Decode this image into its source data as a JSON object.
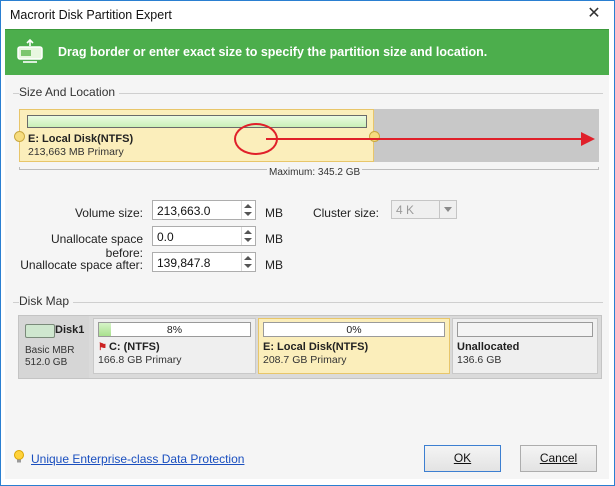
{
  "window": {
    "title": "Macrorit Disk Partition Expert",
    "close_glyph": "✕"
  },
  "banner": {
    "text": "Drag border or enter exact size to specify the partition size and location.",
    "icon": "partition-resize-icon"
  },
  "size_location": {
    "section_label": "Size And Location",
    "partition": {
      "name": "E: Local Disk(NTFS)",
      "sub": "213,663 MB Primary"
    },
    "maximum_label": "Maximum: 345.2 GB"
  },
  "fields": {
    "volume_size": {
      "label": "Volume size:",
      "value": "213,663.0",
      "unit": "MB"
    },
    "unalloc_before": {
      "label": "Unallocate space before:",
      "value": "0.0",
      "unit": "MB"
    },
    "unalloc_after": {
      "label": "Unallocate space after:",
      "value": "139,847.8",
      "unit": "MB"
    },
    "cluster_size": {
      "label": "Cluster size:",
      "value": "4 K"
    }
  },
  "disk_map": {
    "section_label": "Disk Map",
    "disk": {
      "name": "Disk1",
      "type": "Basic MBR",
      "size": "512.0 GB"
    },
    "partitions": [
      {
        "pct": "8%",
        "fill": 0.08,
        "name": "C: (NTFS)",
        "sub": "166.8 GB Primary",
        "selected": false
      },
      {
        "pct": "0%",
        "fill": 0.0,
        "name": "E: Local Disk(NTFS)",
        "sub": "208.7 GB Primary",
        "selected": true
      },
      {
        "pct": "",
        "fill": 0.0,
        "name": "Unallocated",
        "sub": "136.6 GB",
        "selected": false
      }
    ]
  },
  "footer": {
    "link": "Unique Enterprise-class Data Protection",
    "ok_label": "OK",
    "cancel_label": "Cancel"
  },
  "colors": {
    "banner": "#4cae4c",
    "selected_partition": "#fbeebb",
    "annotation_red": "#e0202a",
    "link": "#1a4fbf"
  }
}
